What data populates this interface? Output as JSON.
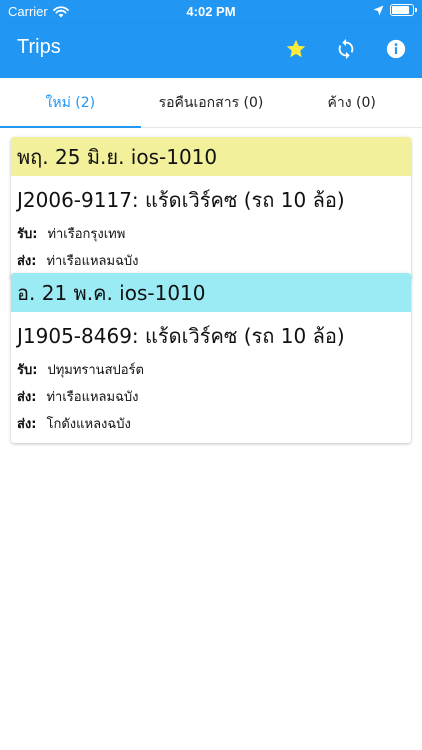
{
  "status": {
    "carrier": "Carrier",
    "time": "4:02 PM",
    "battery_level": 0.9
  },
  "app_bar": {
    "title": "Trips",
    "actions": [
      {
        "icon": "star-icon",
        "color": "#ffeb3b"
      },
      {
        "icon": "sync-icon",
        "color": "#ffffff"
      },
      {
        "icon": "info-icon",
        "color": "#ffffff"
      }
    ],
    "background": "#2196f3"
  },
  "tabs": [
    {
      "label": "ใหม่ (2)",
      "active": true
    },
    {
      "label": "รอคืนเอกสาร (0)",
      "active": false
    },
    {
      "label": "ค้าง (0)",
      "active": false
    }
  ],
  "trips": [
    {
      "header": "พฤ. 25 มิ.ย. ios-1010",
      "header_color": "#f2f09a",
      "title": "J2006-9117: แร้ดเวิร์คซ (รถ 10 ล้อ)",
      "rows": [
        {
          "label": "รับ:",
          "value": "ท่าเรือกรุงเทพ"
        },
        {
          "label": "ส่ง:",
          "value": "ท่าเรือแหลมฉบัง"
        }
      ]
    },
    {
      "header": "อ. 21 พ.ค. ios-1010",
      "header_color": "#9bebf5",
      "title": "J1905-8469: แร้ดเวิร์คซ (รถ 10 ล้อ)",
      "rows": [
        {
          "label": "รับ:",
          "value": "ปทุมทรานสปอร์ต"
        },
        {
          "label": "ส่ง:",
          "value": "ท่าเรือแหลมฉบัง"
        },
        {
          "label": "ส่ง:",
          "value": "โกดังแหลงฉบัง"
        }
      ]
    }
  ]
}
